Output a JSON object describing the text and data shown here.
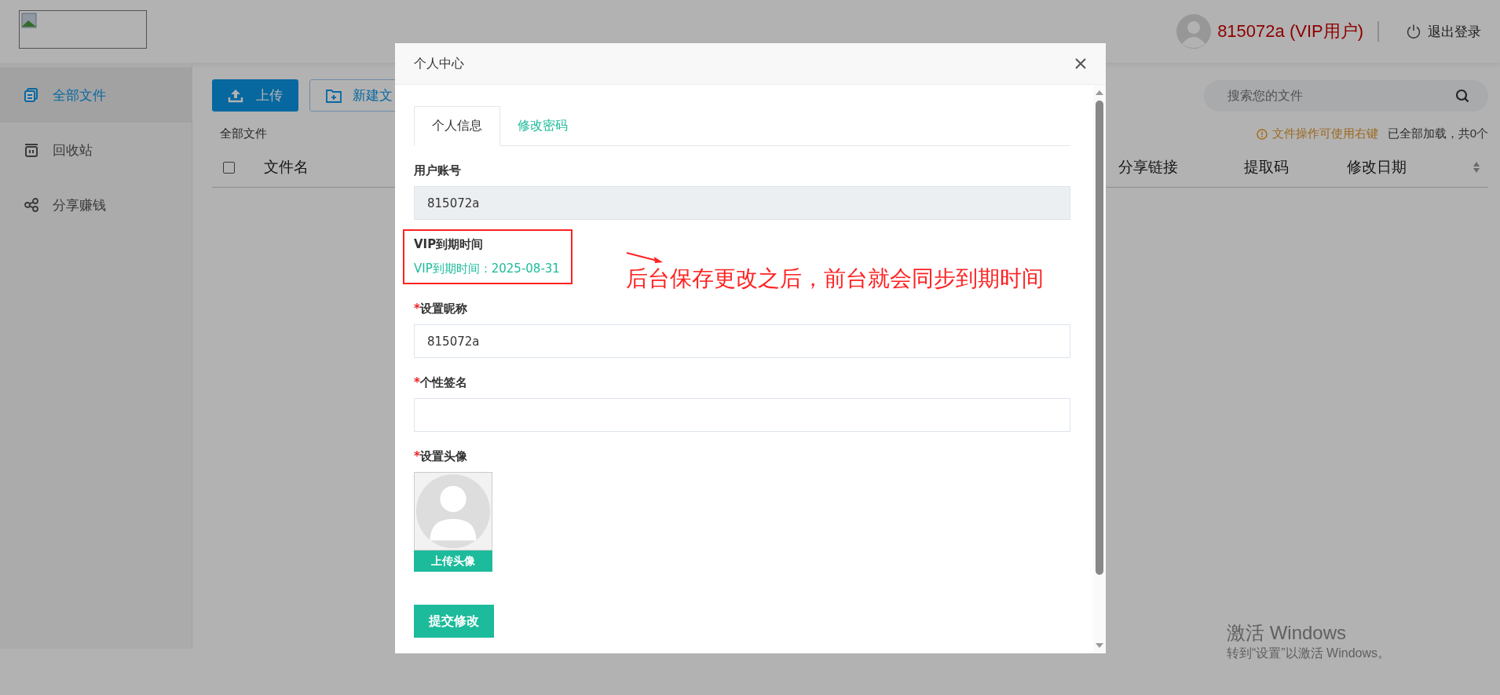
{
  "top_bar": {
    "user_name": "815072a (VIP用户)",
    "logout": "退出登录"
  },
  "sidebar": {
    "items": [
      {
        "label": "全部文件",
        "selected": true,
        "kind": "files"
      },
      {
        "label": "回收站",
        "selected": false,
        "kind": "trash"
      },
      {
        "label": "分享赚钱",
        "selected": false,
        "kind": "share"
      }
    ]
  },
  "toolbar": {
    "upload": "上传",
    "new_folder": "新建文"
  },
  "search": {
    "placeholder": "搜索您的文件"
  },
  "breadcrumb": "全部文件",
  "hint": "文件操作可使用右键",
  "load_status": "已全部加载，共0个",
  "table": {
    "select_all_checked": false,
    "columns": [
      "文件名",
      "分享链接",
      "提取码",
      "修改日期"
    ]
  },
  "dialog": {
    "title": "个人中心",
    "required_mark": "*",
    "tabs": [
      {
        "label": "个人信息",
        "selected": true
      },
      {
        "label": "修改密码",
        "selected": false
      }
    ],
    "fields": [
      {
        "kind": "readonly",
        "label": "用户账号",
        "required": false,
        "value": "815072a"
      },
      {
        "kind": "info",
        "label": "VIP到期时间",
        "required": false,
        "value": "VIP到期时间：2025-08-31",
        "highlighted": true
      },
      {
        "kind": "input",
        "label": "设置昵称",
        "required": true,
        "value": "815072a"
      },
      {
        "kind": "input",
        "label": "个性签名",
        "required": true
      },
      {
        "kind": "avatar",
        "label": "设置头像",
        "required": true,
        "button": "上传头像"
      }
    ],
    "submit": "提交修改"
  },
  "annotation": {
    "text": "后台保存更改之后，前台就会同步到期时间"
  },
  "os_notice": {
    "title": "激活 Windows",
    "subtitle": "转到“设置”以激活 Windows。"
  }
}
